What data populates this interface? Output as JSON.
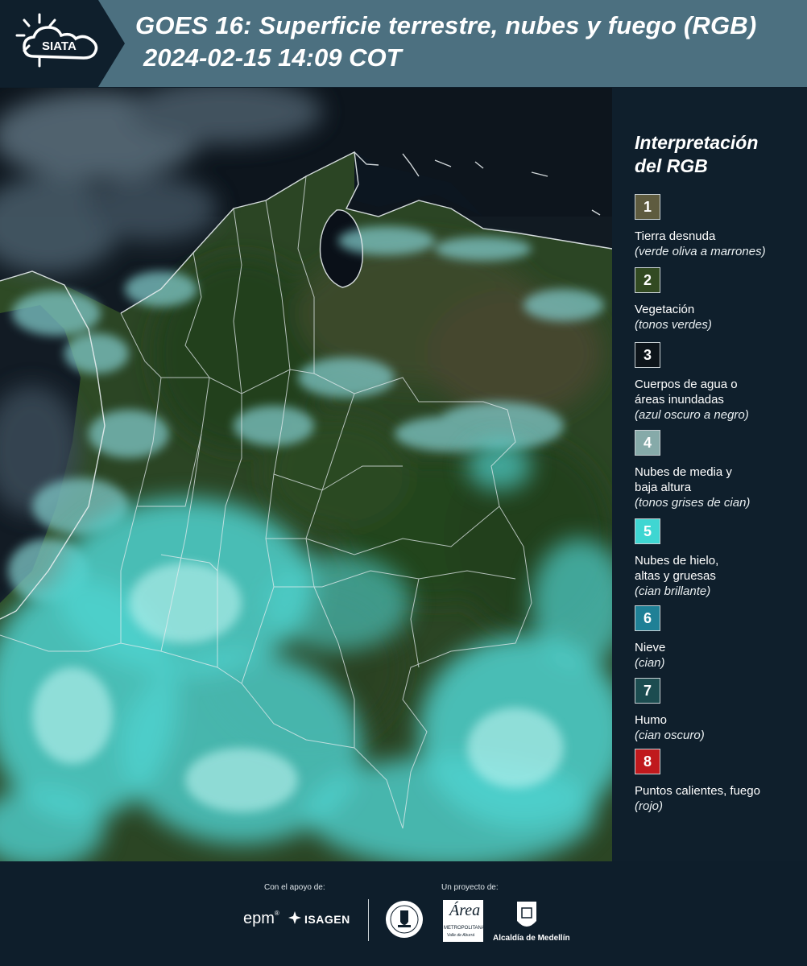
{
  "header": {
    "logo_text": "SIATA",
    "title": "GOES 16: Superficie terrestre, nubes y fuego (RGB)",
    "subtitle": "2024-02-15 14:09 COT"
  },
  "legend": {
    "title_line1": "Interpretación",
    "title_line2": "del RGB",
    "items": [
      {
        "number": "1",
        "label": "Tierra desnuda",
        "desc": "(verde oliva a marrones)",
        "color": "#5e5b3f"
      },
      {
        "number": "2",
        "label": "Vegetación",
        "desc": "(tonos verdes)",
        "color": "#324a22"
      },
      {
        "number": "3",
        "label": "Cuerpos de agua o áreas inundadas",
        "desc": "(azul oscuro a negro)",
        "color": "#0d141a"
      },
      {
        "number": "4",
        "label": "Nubes de media y baja altura",
        "desc": "(tonos grises de cian)",
        "color": "#86aaa9"
      },
      {
        "number": "5",
        "label": "Nubes de hielo, altas y gruesas",
        "desc": "(cian brillante)",
        "color": "#3fd6d2"
      },
      {
        "number": "6",
        "label": "Nieve",
        "desc": "(cian)",
        "color": "#1f8096"
      },
      {
        "number": "7",
        "label": "Humo",
        "desc": "(cian oscuro)",
        "color": "#1c4c50"
      },
      {
        "number": "8",
        "label": "Puntos calientes, fuego",
        "desc": "(rojo)",
        "color": "#c0191d"
      }
    ]
  },
  "footer": {
    "support_label": "Con el apoyo de:",
    "project_label": "Un proyecto de:",
    "epm": "epm",
    "isagen": "ISAGEN",
    "area_logo": "Área",
    "area_caption": "METROPOLITANA",
    "area_subcaption": "Valle de Aburrá",
    "alcaldia": "Alcaldía de Medellín"
  }
}
